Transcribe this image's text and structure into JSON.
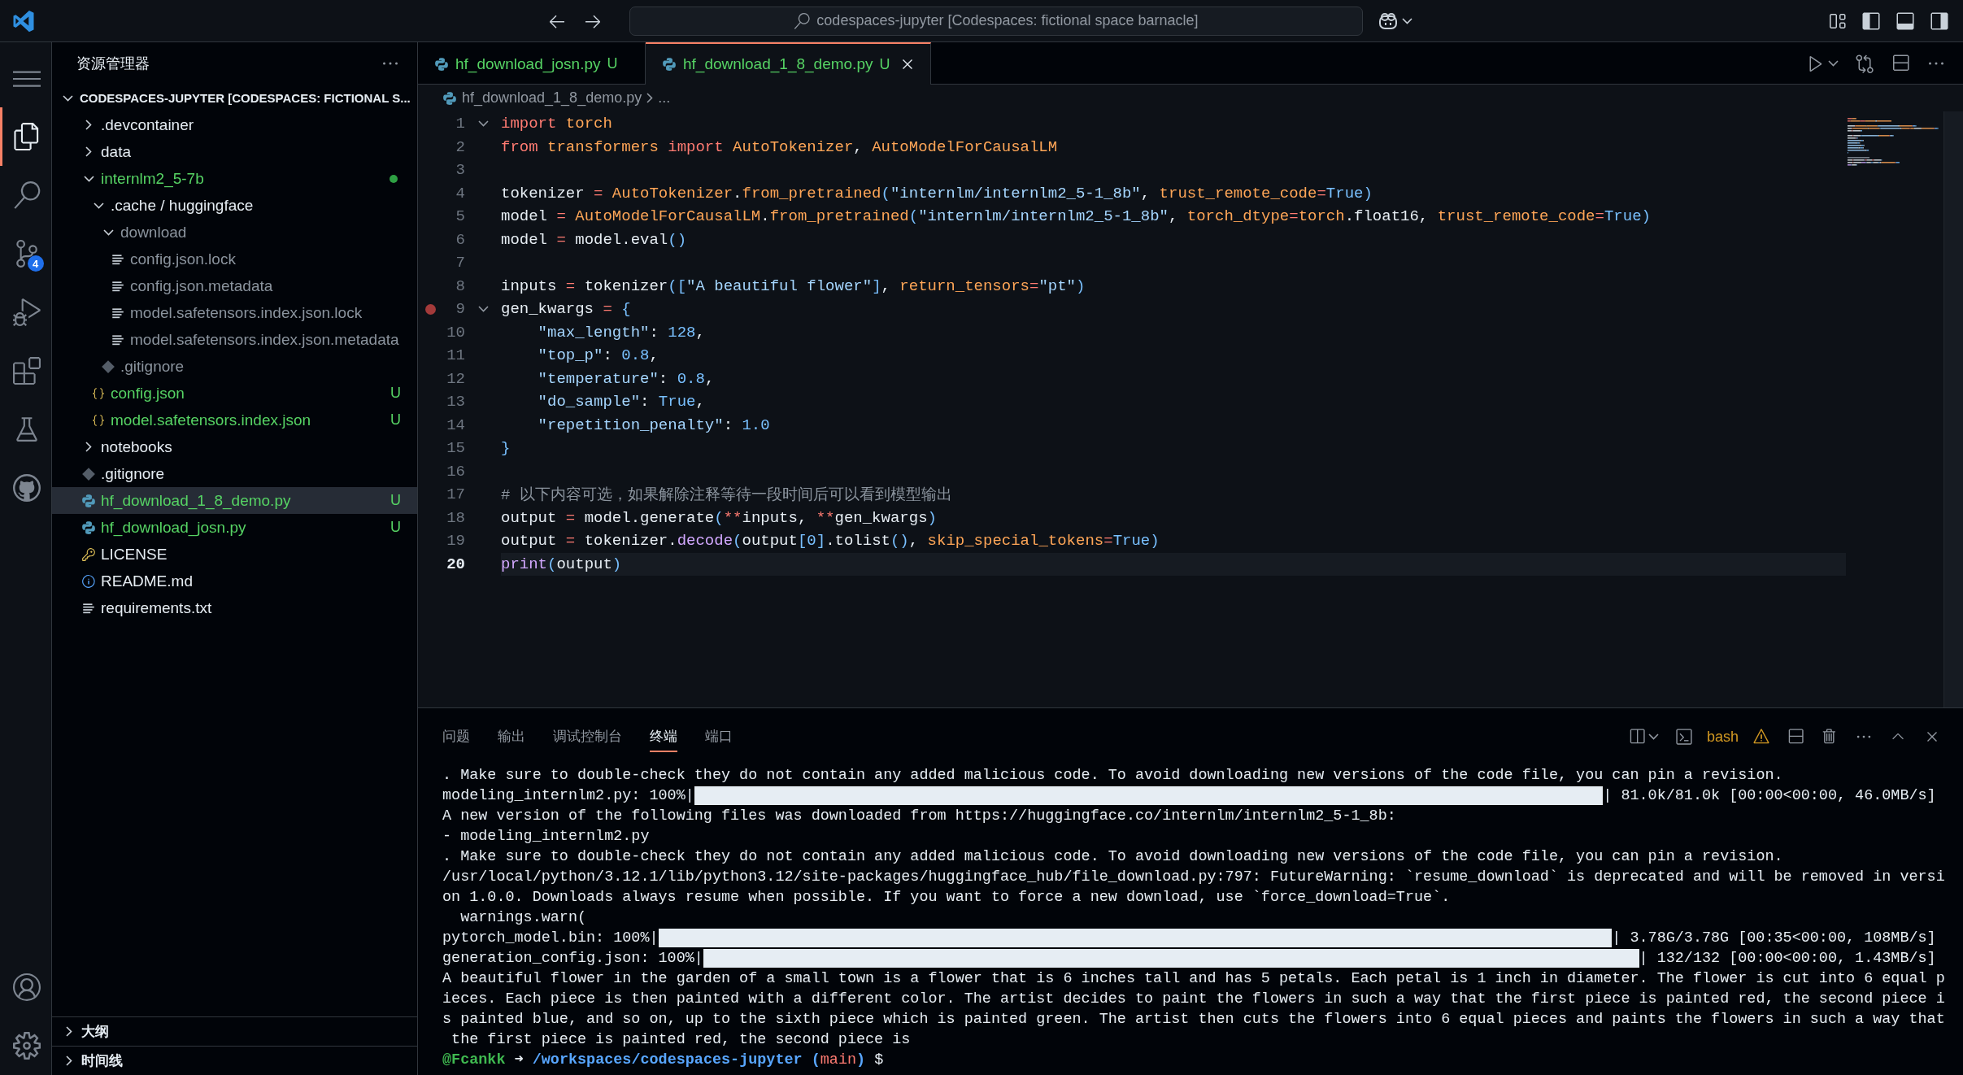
{
  "title_bar": {
    "search": "codespaces-jupyter [Codespaces: fictional space barnacle]"
  },
  "activity_bar": {
    "top": [
      {
        "kind": "menu",
        "selected": false
      },
      {
        "kind": "explorer",
        "selected": true
      },
      {
        "kind": "search",
        "selected": false
      },
      {
        "kind": "source-control",
        "selected": false,
        "badge": "4"
      },
      {
        "kind": "run-debug",
        "selected": false
      },
      {
        "kind": "extensions",
        "selected": false
      },
      {
        "kind": "testing",
        "selected": false
      },
      {
        "kind": "github",
        "selected": false
      }
    ],
    "bottom": [
      {
        "kind": "account"
      },
      {
        "kind": "settings"
      }
    ]
  },
  "explorer": {
    "title": "资源管理器",
    "root": {
      "label": "CODESPACES-JUPYTER [CODESPACES: FICTIONAL S...",
      "expanded": true,
      "children": [
        {
          "kind": "folder",
          "label": ".devcontainer",
          "expanded": false,
          "selected": false,
          "untracked": false,
          "ignored": false,
          "changes_dot": false
        },
        {
          "kind": "folder",
          "label": "data",
          "expanded": false,
          "selected": false,
          "untracked": false,
          "ignored": false,
          "changes_dot": false
        },
        {
          "kind": "folder",
          "label": "internlm2_5-7b",
          "expanded": true,
          "selected": false,
          "untracked": true,
          "ignored": false,
          "changes_dot": true,
          "children": [
            {
              "kind": "folder",
              "label": ".cache / huggingface",
              "expanded": true,
              "selected": false,
              "untracked": false,
              "ignored": false,
              "changes_dot": false,
              "children": [
                {
                  "kind": "folder",
                  "label": "download",
                  "expanded": true,
                  "selected": false,
                  "untracked": false,
                  "ignored": true,
                  "changes_dot": false,
                  "children": [
                    {
                      "kind": "text",
                      "label": "config.json.lock",
                      "selected": false,
                      "untracked": false,
                      "ignored": true
                    },
                    {
                      "kind": "text",
                      "label": "config.json.metadata",
                      "selected": false,
                      "untracked": false,
                      "ignored": true
                    },
                    {
                      "kind": "text",
                      "label": "model.safetensors.index.json.lock",
                      "selected": false,
                      "untracked": false,
                      "ignored": true
                    },
                    {
                      "kind": "text",
                      "label": "model.safetensors.index.json.metadata",
                      "selected": false,
                      "untracked": false,
                      "ignored": true
                    }
                  ]
                },
                {
                  "kind": "git",
                  "label": ".gitignore",
                  "selected": false,
                  "untracked": false,
                  "ignored": true
                }
              ]
            },
            {
              "kind": "json",
              "label": "config.json",
              "selected": false,
              "untracked": true,
              "ignored": false,
              "badge": "U"
            },
            {
              "kind": "json",
              "label": "model.safetensors.index.json",
              "selected": false,
              "untracked": true,
              "ignored": false,
              "badge": "U"
            }
          ]
        },
        {
          "kind": "folder",
          "label": "notebooks",
          "expanded": false,
          "selected": false,
          "untracked": false,
          "ignored": false,
          "changes_dot": false
        },
        {
          "kind": "git",
          "label": ".gitignore",
          "selected": false,
          "untracked": false,
          "ignored": false
        },
        {
          "kind": "python",
          "label": "hf_download_1_8_demo.py",
          "selected": true,
          "untracked": true,
          "ignored": false,
          "badge": "U"
        },
        {
          "kind": "python",
          "label": "hf_download_josn.py",
          "selected": false,
          "untracked": true,
          "ignored": false,
          "badge": "U"
        },
        {
          "kind": "license",
          "label": "LICENSE",
          "selected": false,
          "untracked": false,
          "ignored": false
        },
        {
          "kind": "info",
          "label": "README.md",
          "selected": false,
          "untracked": false,
          "ignored": false
        },
        {
          "kind": "text",
          "label": "requirements.txt",
          "selected": false,
          "untracked": false,
          "ignored": false
        }
      ]
    },
    "sections": [
      {
        "label": "大纲",
        "expanded": false
      },
      {
        "label": "时间线",
        "expanded": false
      }
    ]
  },
  "editor_tabs": [
    {
      "label": "hf_download_josn.py",
      "badge": "U",
      "selected": false
    },
    {
      "label": "hf_download_1_8_demo.py",
      "badge": "U",
      "selected": true
    }
  ],
  "breadcrumb": [
    "hf_download_1_8_demo.py",
    "..."
  ],
  "code": [
    {
      "number": "1",
      "foldable": true,
      "breakpoint": false,
      "current": false,
      "tokens": [
        {
          "kind": "kw",
          "text": "import"
        },
        {
          "kind": "cls",
          "text": " torch"
        }
      ]
    },
    {
      "number": "2",
      "foldable": false,
      "breakpoint": false,
      "current": false,
      "tokens": [
        {
          "kind": "kw",
          "text": "from"
        },
        {
          "kind": "cls",
          "text": " transformers"
        },
        {
          "kind": "kw",
          "text": " import"
        },
        {
          "kind": "cls",
          "text": " AutoTokenizer"
        },
        {
          "kind": "plain",
          "text": ", "
        },
        {
          "kind": "cls",
          "text": "AutoModelForCausalLM"
        }
      ]
    },
    {
      "number": "3",
      "foldable": false,
      "breakpoint": false,
      "current": false
    },
    {
      "number": "4",
      "foldable": false,
      "breakpoint": false,
      "current": false,
      "tokens": [
        {
          "kind": "plain",
          "text": "tokenizer "
        },
        {
          "kind": "op",
          "text": "="
        },
        {
          "kind": "cls",
          "text": " AutoTokenizer"
        },
        {
          "kind": "plain",
          "text": "."
        },
        {
          "kind": "cls",
          "text": "from_pretrained"
        },
        {
          "kind": "punct",
          "text": "("
        },
        {
          "kind": "str",
          "text": "\"internlm/internlm2_5-1_8b\""
        },
        {
          "kind": "plain",
          "text": ", "
        },
        {
          "kind": "cls",
          "text": "trust_remote_code"
        },
        {
          "kind": "op",
          "text": "="
        },
        {
          "kind": "const",
          "text": "True"
        },
        {
          "kind": "punct",
          "text": ")"
        }
      ]
    },
    {
      "number": "5",
      "foldable": false,
      "breakpoint": false,
      "current": false,
      "tokens": [
        {
          "kind": "plain",
          "text": "model "
        },
        {
          "kind": "op",
          "text": "="
        },
        {
          "kind": "cls",
          "text": " AutoModelForCausalLM"
        },
        {
          "kind": "plain",
          "text": "."
        },
        {
          "kind": "cls",
          "text": "from_pretrained"
        },
        {
          "kind": "punct",
          "text": "("
        },
        {
          "kind": "str",
          "text": "\"internlm/internlm2_5-1_8b\""
        },
        {
          "kind": "plain",
          "text": ", "
        },
        {
          "kind": "cls",
          "text": "torch_dtype"
        },
        {
          "kind": "op",
          "text": "="
        },
        {
          "kind": "cls",
          "text": "torch"
        },
        {
          "kind": "plain",
          "text": ".float16, "
        },
        {
          "kind": "cls",
          "text": "trust_remote_code"
        },
        {
          "kind": "op",
          "text": "="
        },
        {
          "kind": "const",
          "text": "True"
        },
        {
          "kind": "punct",
          "text": ")"
        }
      ]
    },
    {
      "number": "6",
      "foldable": false,
      "breakpoint": false,
      "current": false,
      "tokens": [
        {
          "kind": "plain",
          "text": "model "
        },
        {
          "kind": "op",
          "text": "="
        },
        {
          "kind": "plain",
          "text": " model.eval"
        },
        {
          "kind": "punct",
          "text": "()"
        }
      ]
    },
    {
      "number": "7",
      "foldable": false,
      "breakpoint": false,
      "current": false
    },
    {
      "number": "8",
      "foldable": false,
      "breakpoint": false,
      "current": false,
      "tokens": [
        {
          "kind": "plain",
          "text": "inputs "
        },
        {
          "kind": "op",
          "text": "="
        },
        {
          "kind": "plain",
          "text": " tokenizer"
        },
        {
          "kind": "punct",
          "text": "(["
        },
        {
          "kind": "str",
          "text": "\"A beautiful flower\""
        },
        {
          "kind": "punct",
          "text": "]"
        },
        {
          "kind": "plain",
          "text": ", "
        },
        {
          "kind": "cls",
          "text": "return_tensors"
        },
        {
          "kind": "op",
          "text": "="
        },
        {
          "kind": "str",
          "text": "\"pt\""
        },
        {
          "kind": "punct",
          "text": ")"
        }
      ]
    },
    {
      "number": "9",
      "foldable": true,
      "breakpoint": true,
      "current": false,
      "tokens": [
        {
          "kind": "plain",
          "text": "gen_kwargs "
        },
        {
          "kind": "op",
          "text": "="
        },
        {
          "kind": "punct",
          "text": " {"
        }
      ]
    },
    {
      "number": "10",
      "foldable": false,
      "breakpoint": false,
      "current": false,
      "tokens": [
        {
          "kind": "str",
          "text": "    \"max_length\""
        },
        {
          "kind": "plain",
          "text": ": "
        },
        {
          "kind": "const",
          "text": "128"
        },
        {
          "kind": "plain",
          "text": ","
        }
      ]
    },
    {
      "number": "11",
      "foldable": false,
      "breakpoint": false,
      "current": false,
      "tokens": [
        {
          "kind": "str",
          "text": "    \"top_p\""
        },
        {
          "kind": "plain",
          "text": ": "
        },
        {
          "kind": "const",
          "text": "0.8"
        },
        {
          "kind": "plain",
          "text": ","
        }
      ]
    },
    {
      "number": "12",
      "foldable": false,
      "breakpoint": false,
      "current": false,
      "tokens": [
        {
          "kind": "str",
          "text": "    \"temperature\""
        },
        {
          "kind": "plain",
          "text": ": "
        },
        {
          "kind": "const",
          "text": "0.8"
        },
        {
          "kind": "plain",
          "text": ","
        }
      ]
    },
    {
      "number": "13",
      "foldable": false,
      "breakpoint": false,
      "current": false,
      "tokens": [
        {
          "kind": "str",
          "text": "    \"do_sample\""
        },
        {
          "kind": "plain",
          "text": ": "
        },
        {
          "kind": "const",
          "text": "True"
        },
        {
          "kind": "plain",
          "text": ","
        }
      ]
    },
    {
      "number": "14",
      "foldable": false,
      "breakpoint": false,
      "current": false,
      "tokens": [
        {
          "kind": "str",
          "text": "    \"repetition_penalty\""
        },
        {
          "kind": "plain",
          "text": ": "
        },
        {
          "kind": "const",
          "text": "1.0"
        }
      ]
    },
    {
      "number": "15",
      "foldable": false,
      "breakpoint": false,
      "current": false,
      "tokens": [
        {
          "kind": "punct",
          "text": "}"
        }
      ]
    },
    {
      "number": "16",
      "foldable": false,
      "breakpoint": false,
      "current": false
    },
    {
      "number": "17",
      "foldable": false,
      "breakpoint": false,
      "current": false,
      "tokens": [
        {
          "kind": "comment",
          "text": "# 以下内容可选，如果解除注释等待一段时间后可以看到模型输出"
        }
      ]
    },
    {
      "number": "18",
      "foldable": false,
      "breakpoint": false,
      "current": false,
      "tokens": [
        {
          "kind": "plain",
          "text": "output "
        },
        {
          "kind": "op",
          "text": "="
        },
        {
          "kind": "plain",
          "text": " model.generate"
        },
        {
          "kind": "punct",
          "text": "("
        },
        {
          "kind": "op",
          "text": "**"
        },
        {
          "kind": "plain",
          "text": "inputs, "
        },
        {
          "kind": "op",
          "text": "**"
        },
        {
          "kind": "plain",
          "text": "gen_kwargs"
        },
        {
          "kind": "punct",
          "text": ")"
        }
      ]
    },
    {
      "number": "19",
      "foldable": false,
      "breakpoint": false,
      "current": false,
      "tokens": [
        {
          "kind": "plain",
          "text": "output "
        },
        {
          "kind": "op",
          "text": "="
        },
        {
          "kind": "plain",
          "text": " tokenizer."
        },
        {
          "kind": "fn",
          "text": "decode"
        },
        {
          "kind": "punct",
          "text": "("
        },
        {
          "kind": "plain",
          "text": "output"
        },
        {
          "kind": "punct",
          "text": "["
        },
        {
          "kind": "const",
          "text": "0"
        },
        {
          "kind": "punct",
          "text": "]"
        },
        {
          "kind": "plain",
          "text": ".tolist"
        },
        {
          "kind": "punct",
          "text": "()"
        },
        {
          "kind": "plain",
          "text": ", "
        },
        {
          "kind": "cls",
          "text": "skip_special_tokens"
        },
        {
          "kind": "op",
          "text": "="
        },
        {
          "kind": "const",
          "text": "True"
        },
        {
          "kind": "punct",
          "text": ")"
        }
      ]
    },
    {
      "number": "20",
      "foldable": false,
      "breakpoint": false,
      "current": true,
      "tokens": [
        {
          "kind": "fn",
          "text": "print"
        },
        {
          "kind": "punct",
          "text": "("
        },
        {
          "kind": "plain",
          "text": "output"
        },
        {
          "kind": "punct",
          "text": ")"
        }
      ]
    }
  ],
  "panel": {
    "tabs": [
      {
        "label": "问题",
        "selected": false
      },
      {
        "label": "输出",
        "selected": false
      },
      {
        "label": "调试控制台",
        "selected": false
      },
      {
        "label": "终端",
        "selected": true
      },
      {
        "label": "端口",
        "selected": false
      }
    ],
    "terminal_name": "bash",
    "terminal": [
      {
        "kind": "text",
        "text": ". Make sure to double-check they do not contain any added malicious code. To avoid downloading new versions of the code file, you can pin a revision."
      },
      {
        "kind": "progress",
        "label": "modeling_internlm2.py: 100%|",
        "level": 1,
        "stats": "| 81.0k/81.0k [00:00<00:00, 46.0MB/s]"
      },
      {
        "kind": "text",
        "text": "A new version of the following files was downloaded from https://huggingface.co/internlm/internlm2_5-1_8b:"
      },
      {
        "kind": "text",
        "text": "- modeling_internlm2.py"
      },
      {
        "kind": "text",
        "text": ". Make sure to double-check they do not contain any added malicious code. To avoid downloading new versions of the code file, you can pin a revision."
      },
      {
        "kind": "text",
        "text": "/usr/local/python/3.12.1/lib/python3.12/site-packages/huggingface_hub/file_download.py:797: FutureWarning: `resume_download` is deprecated and will be removed in versi"
      },
      {
        "kind": "text",
        "text": "on 1.0.0. Downloads always resume when possible. If you want to force a new download, use `force_download=True`."
      },
      {
        "kind": "text",
        "text": "  warnings.warn("
      },
      {
        "kind": "progress",
        "label": "pytorch_model.bin: 100%|",
        "level": 1,
        "stats": "| 3.78G/3.78G [00:35<00:00, 108MB/s]"
      },
      {
        "kind": "progress",
        "label": "generation_config.json: 100%|",
        "level": 1,
        "stats": "| 132/132 [00:00<00:00, 1.43MB/s]"
      },
      {
        "kind": "text",
        "text": "A beautiful flower in the garden of a small town is a flower that is 6 inches tall and has 5 petals. Each petal is 1 inch in diameter. The flower is cut into 6 equal p"
      },
      {
        "kind": "text",
        "text": "ieces. Each piece is then painted with a different color. The artist decides to paint the flowers in such a way that the first piece is painted red, the second piece i"
      },
      {
        "kind": "text",
        "text": "s painted blue, and so on, up to the sixth piece which is painted green. The artist then cuts the flowers into 6 equal pieces and paints the flowers in such a way that"
      },
      {
        "kind": "text",
        "text": " the first piece is painted red, the second piece is"
      },
      {
        "kind": "prompt",
        "parts": [
          {
            "kind": "user",
            "text": "@Fcankk "
          },
          {
            "kind": "arrow",
            "text": "➜ "
          },
          {
            "kind": "path",
            "text": "/workspaces/codespaces-jupyter ("
          },
          {
            "kind": "branch",
            "text": "main"
          },
          {
            "kind": "path",
            "text": ")"
          },
          {
            "kind": "symbol",
            "text": " $"
          }
        ]
      }
    ]
  }
}
